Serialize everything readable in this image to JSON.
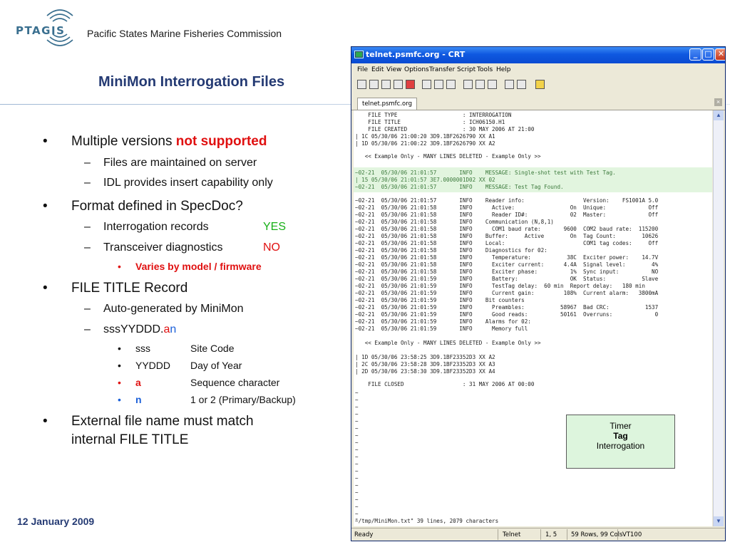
{
  "header": {
    "logo_text": "PTAGIS",
    "org_name": "Pacific States Marine Fisheries Commission",
    "slide_title": "MiniMon Interrogation Files"
  },
  "bullets": {
    "b1": {
      "text": "Multiple versions ",
      "emph": "not supported",
      "sub1": "Files are maintained on server",
      "sub2": "IDL provides insert capability only"
    },
    "b2": {
      "text": "Format defined in SpecDoc?",
      "sub1_label": "Interrogation records",
      "sub1_value": "YES",
      "sub2_label": "Transceiver diagnostics",
      "sub2_value": "NO",
      "sub2_note": "Varies by model / firmware"
    },
    "b3": {
      "text": "FILE TITLE Record",
      "sub1": "Auto-generated by MiniMon",
      "sub2_prefix": "sssYYDDD.",
      "sub2_a": "a",
      "sub2_n": "n",
      "items": [
        {
          "key": "sss",
          "desc": "Site Code",
          "color": "#111111"
        },
        {
          "key": "YYDDD",
          "desc": "Day of Year",
          "color": "#111111"
        },
        {
          "key": "a",
          "desc": "Sequence character",
          "color": "#e01010"
        },
        {
          "key": "n",
          "desc": "1 or 2 (Primary/Backup)",
          "color": "#1a5fd8"
        }
      ]
    },
    "b4": {
      "line1": "External file name must match",
      "line2": "internal FILE TITLE"
    }
  },
  "footer": {
    "date": "12 January 2009"
  },
  "window": {
    "title": "telnet.psmfc.org - CRT",
    "menu": [
      "File",
      "Edit",
      "View",
      "Options",
      "Transfer",
      "Script",
      "Tools",
      "Help"
    ],
    "tab_label": "telnet.psmfc.org",
    "status": {
      "ready": "Ready",
      "protocol": "Telnet",
      "cursor": "1,  5",
      "size": "59 Rows, 99 Cols",
      "term": "VT100"
    }
  },
  "terminal": {
    "block1": "    FILE TYPE                    : INTERROGATION\n    FILE TITLE                   : ICH06150.H1\n    FILE CREATED                 : 30 MAY 2006 AT 21:00\n| 1C 05/30/06 21:00:20 3D9.1BF2626790 XX A1\n| 1D 05/30/06 21:00:22 3D9.1BF2626790 XX A2",
    "sep1": "   << Example Only - MANY LINES DELETED - Example Only >>",
    "green": "~02-21  05/30/06 21:01:57       INFO    MESSAGE: Single-shot test with Test Tag.\n| 15 05/30/06 21:01:57 3E7.0000001D02 XX 02\n~02-21  05/30/06 21:01:57       INFO    MESSAGE: Test Tag Found.",
    "block2": "~02-21  05/30/06 21:01:57       INFO    Reader info:                  Version:    FS1001A 5.0\n~02-21  05/30/06 21:01:58       INFO      Active:                 On  Unique:             Off\n~02-21  05/30/06 21:01:58       INFO      Reader ID#:             02  Master:             Off\n~02-21  05/30/06 21:01:58       INFO    Communication (N,8,1)\n~02-21  05/30/06 21:01:58       INFO      COM1 baud rate:       9600  COM2 baud rate:  115200\n~02-21  05/30/06 21:01:58       INFO    Buffer:     Active        On  Tag Count:        10626\n~02-21  05/30/06 21:01:58       INFO    Local:                        COM1 tag codes:     Off\n~02-21  05/30/06 21:01:58       INFO    Diagnostics for 02:\n~02-21  05/30/06 21:01:58       INFO      Temperature:           38C  Exciter power:    14.7V\n~02-21  05/30/06 21:01:58       INFO      Exciter current:      4.4A  Signal level:        4%\n~02-21  05/30/06 21:01:58       INFO      Exciter phase:          1%  Sync input:          NO\n~02-21  05/30/06 21:01:59       INFO      Battery:                OK  Status:           Slave\n~02-21  05/30/06 21:01:59       INFO      TestTag delay:  60 min  Report delay:   180 min\n~02-21  05/30/06 21:01:59       INFO      Current gain:         108%  Current alarm:   3800mA\n~02-21  05/30/06 21:01:59       INFO    Bit counters\n~02-21  05/30/06 21:01:59       INFO      Preambles:           58967  Bad CRC:           1537\n~02-21  05/30/06 21:01:59       INFO      Good reads:          50161  Overruns:             0\n~02-21  05/30/06 21:01:59       INFO    Alarms for 02:\n~02-21  05/30/06 21:01:59       INFO      Memory full",
    "sep2": "   << Example Only - MANY LINES DELETED - Example Only >>",
    "block3": "| 1D 05/30/06 23:58:25 3D9.1BF23352D3 XX A2\n| 2C 05/30/06 23:58:28 3D9.1BF23352D3 XX A3\n| 2D 05/30/06 23:58:30 3D9.1BF23352D3 XX A4",
    "closed": "    FILE CLOSED                  : 31 MAY 2006 AT 00:00",
    "tildes": "~\n~\n~\n~\n~\n~\n~\n~\n~\n~\n~\n~\n~\n~\n~\n~\n~\n~\n~\n~\n~",
    "footer_line": "\"/tmp/MiniMon.txt\" 39 lines, 2079 characters"
  },
  "callout": {
    "line1": "Timer",
    "line2": "Tag",
    "line3": "Interrogation"
  }
}
